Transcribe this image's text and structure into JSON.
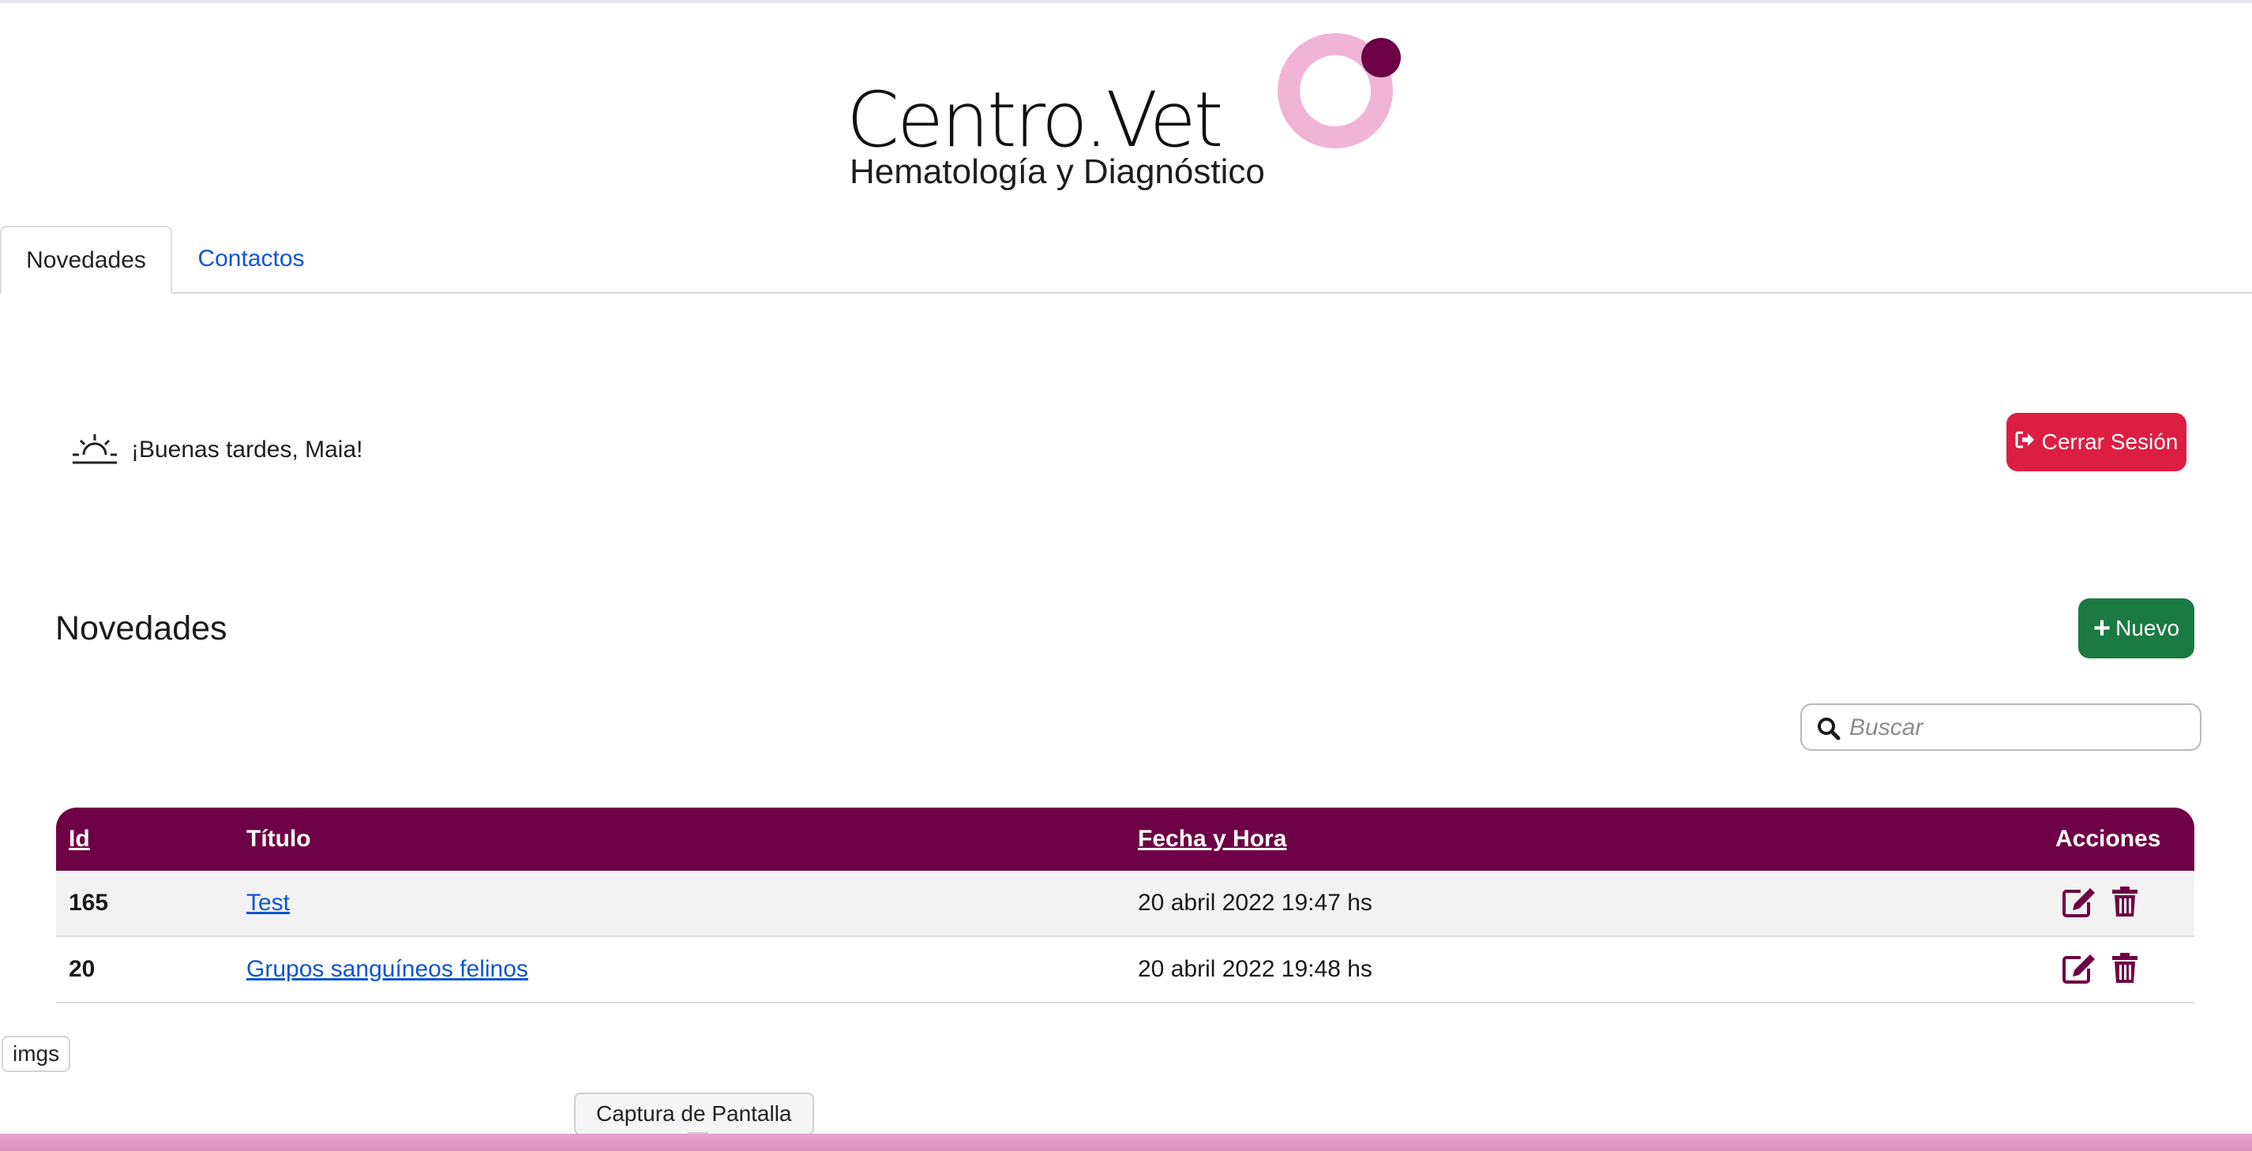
{
  "brand": {
    "wordmark": "Centro.Vet",
    "tagline": "Hematología y Diagnóstico",
    "ring_color": "#f0b4d7",
    "dot_color": "#6e0045"
  },
  "tabs": [
    {
      "label": "Novedades",
      "active": true
    },
    {
      "label": "Contactos",
      "active": false
    }
  ],
  "greeting": {
    "icon": "sunset-icon",
    "text": "¡Buenas tardes, Maia!"
  },
  "logout": {
    "label": "Cerrar Sesión",
    "icon": "sign-out-icon",
    "color": "#dc1e43"
  },
  "section": {
    "title": "Novedades",
    "new_label": "Nuevo",
    "new_color": "#1b7a42"
  },
  "search": {
    "placeholder": "Buscar",
    "value": ""
  },
  "table": {
    "header_color": "#6e0045",
    "columns": [
      {
        "label": "Id",
        "sortable": true
      },
      {
        "label": "Título",
        "sortable": false
      },
      {
        "label": "Fecha y Hora",
        "sortable": true
      },
      {
        "label": "Acciones",
        "sortable": false
      }
    ],
    "rows": [
      {
        "id": "165",
        "title": "Test",
        "datetime": "20 abril 2022 19:47 hs"
      },
      {
        "id": "20",
        "title": "Grupos sanguíneos felinos",
        "datetime": "20 abril 2022 19:48 hs"
      }
    ],
    "action_icons": [
      "edit-icon",
      "trash-icon"
    ]
  },
  "footer": {
    "tag": "imgs",
    "tooltip": "Captura de Pantalla"
  }
}
